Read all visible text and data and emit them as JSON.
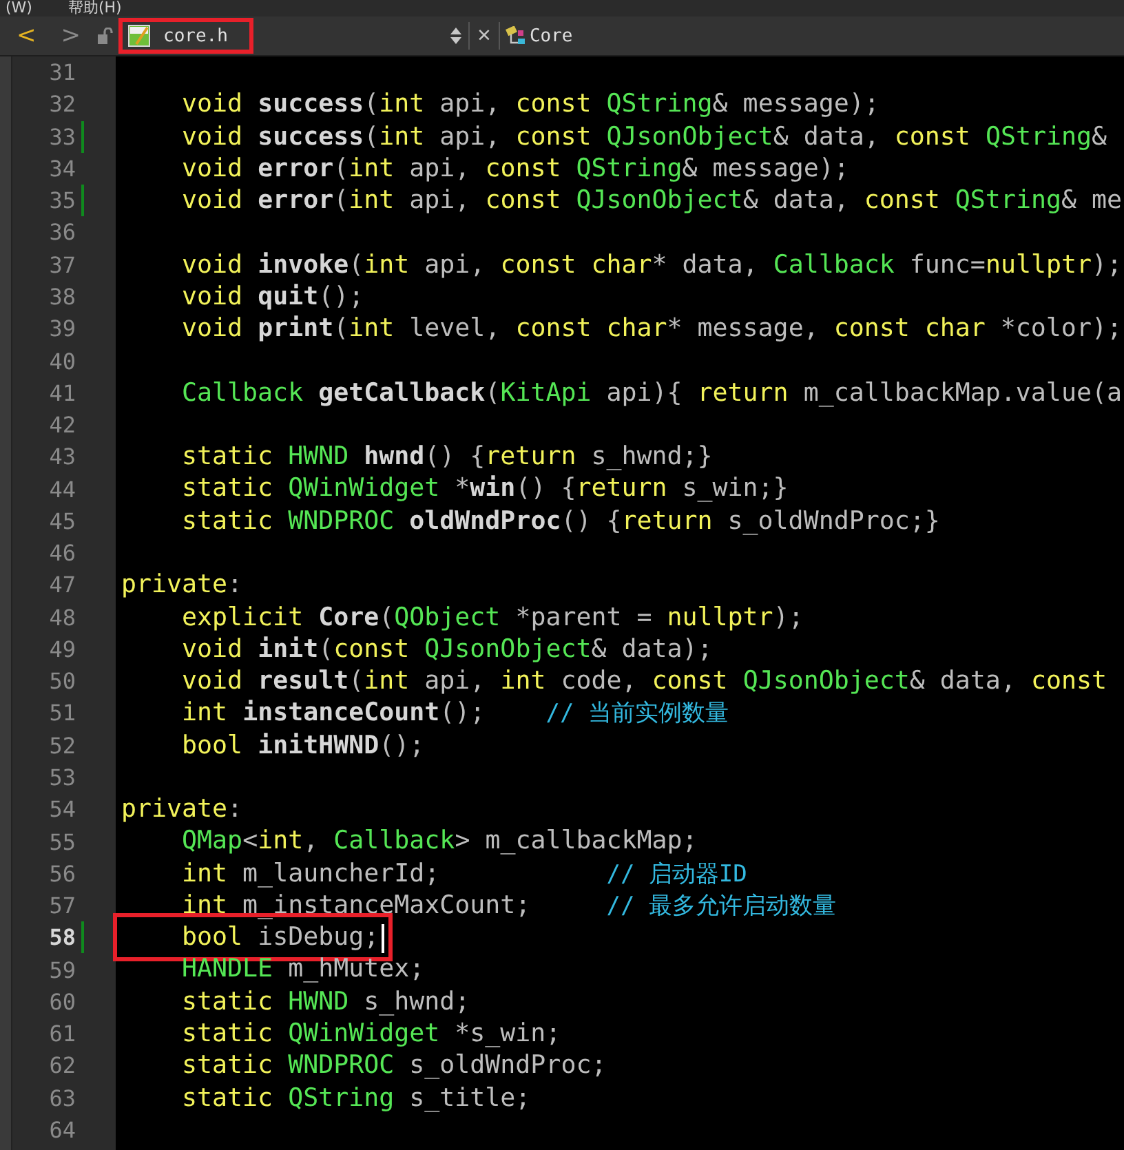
{
  "menu": [
    {
      "label": "(W)"
    },
    {
      "label": "帮助(H)"
    }
  ],
  "toolbar": {
    "back": {
      "label": "<",
      "disabled": false
    },
    "forward": {
      "label": ">",
      "disabled": true
    },
    "file": {
      "label": "core.h",
      "highlighted": true
    },
    "close": {
      "label": "×"
    },
    "symbol": {
      "label": "Core"
    }
  },
  "lines": [
    {
      "number": "31",
      "changed": false,
      "current": false
    },
    {
      "number": "32",
      "changed": false,
      "current": false,
      "tokens": [
        {
          "kind": "kw",
          "text": "    void "
        },
        {
          "kind": "fn",
          "text": "success"
        },
        {
          "kind": "pl",
          "text": "("
        },
        {
          "kind": "kw",
          "text": "int"
        },
        {
          "kind": "pl",
          "text": " api, "
        },
        {
          "kind": "kw",
          "text": "const "
        },
        {
          "kind": "ty",
          "text": "QString"
        },
        {
          "kind": "pl",
          "text": "& message);"
        }
      ]
    },
    {
      "number": "33",
      "changed": true,
      "current": false,
      "tokens": [
        {
          "kind": "kw",
          "text": "    void "
        },
        {
          "kind": "fn",
          "text": "success"
        },
        {
          "kind": "pl",
          "text": "("
        },
        {
          "kind": "kw",
          "text": "int"
        },
        {
          "kind": "pl",
          "text": " api, "
        },
        {
          "kind": "kw",
          "text": "const "
        },
        {
          "kind": "ty",
          "text": "QJsonObject"
        },
        {
          "kind": "pl",
          "text": "& data, "
        },
        {
          "kind": "kw",
          "text": "const "
        },
        {
          "kind": "ty",
          "text": "QString"
        },
        {
          "kind": "pl",
          "text": "&"
        }
      ]
    },
    {
      "number": "34",
      "changed": false,
      "current": false,
      "tokens": [
        {
          "kind": "kw",
          "text": "    void "
        },
        {
          "kind": "fn",
          "text": "error"
        },
        {
          "kind": "pl",
          "text": "("
        },
        {
          "kind": "kw",
          "text": "int"
        },
        {
          "kind": "pl",
          "text": " api, "
        },
        {
          "kind": "kw",
          "text": "const "
        },
        {
          "kind": "ty",
          "text": "QString"
        },
        {
          "kind": "pl",
          "text": "& message);"
        }
      ]
    },
    {
      "number": "35",
      "changed": true,
      "current": false,
      "tokens": [
        {
          "kind": "kw",
          "text": "    void "
        },
        {
          "kind": "fn",
          "text": "error"
        },
        {
          "kind": "pl",
          "text": "("
        },
        {
          "kind": "kw",
          "text": "int"
        },
        {
          "kind": "pl",
          "text": " api, "
        },
        {
          "kind": "kw",
          "text": "const "
        },
        {
          "kind": "ty",
          "text": "QJsonObject"
        },
        {
          "kind": "pl",
          "text": "& data, "
        },
        {
          "kind": "kw",
          "text": "const "
        },
        {
          "kind": "ty",
          "text": "QString"
        },
        {
          "kind": "pl",
          "text": "& me"
        }
      ]
    },
    {
      "number": "36",
      "changed": false,
      "current": false
    },
    {
      "number": "37",
      "changed": false,
      "current": false,
      "tokens": [
        {
          "kind": "kw",
          "text": "    void "
        },
        {
          "kind": "fn",
          "text": "invoke"
        },
        {
          "kind": "pl",
          "text": "("
        },
        {
          "kind": "kw",
          "text": "int"
        },
        {
          "kind": "pl",
          "text": " api, "
        },
        {
          "kind": "kw",
          "text": "const char"
        },
        {
          "kind": "pl",
          "text": "* data, "
        },
        {
          "kind": "ty",
          "text": "Callback"
        },
        {
          "kind": "pl",
          "text": " func="
        },
        {
          "kind": "kw",
          "text": "nullptr"
        },
        {
          "kind": "pl",
          "text": ");"
        }
      ]
    },
    {
      "number": "38",
      "changed": false,
      "current": false,
      "tokens": [
        {
          "kind": "kw",
          "text": "    void "
        },
        {
          "kind": "fn",
          "text": "quit"
        },
        {
          "kind": "pl",
          "text": "();"
        }
      ]
    },
    {
      "number": "39",
      "changed": false,
      "current": false,
      "tokens": [
        {
          "kind": "kw",
          "text": "    void "
        },
        {
          "kind": "fn",
          "text": "print"
        },
        {
          "kind": "pl",
          "text": "("
        },
        {
          "kind": "kw",
          "text": "int"
        },
        {
          "kind": "pl",
          "text": " level, "
        },
        {
          "kind": "kw",
          "text": "const char"
        },
        {
          "kind": "pl",
          "text": "* message, "
        },
        {
          "kind": "kw",
          "text": "const char"
        },
        {
          "kind": "pl",
          "text": " *color);"
        }
      ]
    },
    {
      "number": "40",
      "changed": false,
      "current": false
    },
    {
      "number": "41",
      "changed": false,
      "current": false,
      "tokens": [
        {
          "kind": "ty",
          "text": "    Callback "
        },
        {
          "kind": "fn",
          "text": "getCallback"
        },
        {
          "kind": "pl",
          "text": "("
        },
        {
          "kind": "ty",
          "text": "KitApi"
        },
        {
          "kind": "pl",
          "text": " api){ "
        },
        {
          "kind": "kw",
          "text": "return"
        },
        {
          "kind": "pl",
          "text": " m_callbackMap.value(a"
        }
      ]
    },
    {
      "number": "42",
      "changed": false,
      "current": false
    },
    {
      "number": "43",
      "changed": false,
      "current": false,
      "tokens": [
        {
          "kind": "kw",
          "text": "    static "
        },
        {
          "kind": "ty",
          "text": "HWND "
        },
        {
          "kind": "fn",
          "text": "hwnd"
        },
        {
          "kind": "pl",
          "text": "() {"
        },
        {
          "kind": "kw",
          "text": "return"
        },
        {
          "kind": "pl",
          "text": " s_hwnd;}"
        }
      ]
    },
    {
      "number": "44",
      "changed": false,
      "current": false,
      "tokens": [
        {
          "kind": "kw",
          "text": "    static "
        },
        {
          "kind": "ty",
          "text": "QWinWidget"
        },
        {
          "kind": "pl",
          "text": " *"
        },
        {
          "kind": "fn",
          "text": "win"
        },
        {
          "kind": "pl",
          "text": "() {"
        },
        {
          "kind": "kw",
          "text": "return"
        },
        {
          "kind": "pl",
          "text": " s_win;}"
        }
      ]
    },
    {
      "number": "45",
      "changed": false,
      "current": false,
      "tokens": [
        {
          "kind": "kw",
          "text": "    static "
        },
        {
          "kind": "ty",
          "text": "WNDPROC "
        },
        {
          "kind": "fn",
          "text": "oldWndProc"
        },
        {
          "kind": "pl",
          "text": "() {"
        },
        {
          "kind": "kw",
          "text": "return"
        },
        {
          "kind": "pl",
          "text": " s_oldWndProc;}"
        }
      ]
    },
    {
      "number": "46",
      "changed": false,
      "current": false
    },
    {
      "number": "47",
      "changed": false,
      "current": false,
      "tokens": [
        {
          "kind": "kw",
          "text": "private"
        },
        {
          "kind": "pl",
          "text": ":"
        }
      ]
    },
    {
      "number": "48",
      "changed": false,
      "current": false,
      "tokens": [
        {
          "kind": "kw",
          "text": "    explicit "
        },
        {
          "kind": "fn",
          "text": "Core"
        },
        {
          "kind": "pl",
          "text": "("
        },
        {
          "kind": "ty",
          "text": "QObject"
        },
        {
          "kind": "pl",
          "text": " *parent = "
        },
        {
          "kind": "kw",
          "text": "nullptr"
        },
        {
          "kind": "pl",
          "text": ");"
        }
      ]
    },
    {
      "number": "49",
      "changed": false,
      "current": false,
      "tokens": [
        {
          "kind": "kw",
          "text": "    void "
        },
        {
          "kind": "fn",
          "text": "init"
        },
        {
          "kind": "pl",
          "text": "("
        },
        {
          "kind": "kw",
          "text": "const "
        },
        {
          "kind": "ty",
          "text": "QJsonObject"
        },
        {
          "kind": "pl",
          "text": "& data);"
        }
      ]
    },
    {
      "number": "50",
      "changed": false,
      "current": false,
      "tokens": [
        {
          "kind": "kw",
          "text": "    void "
        },
        {
          "kind": "fn",
          "text": "result"
        },
        {
          "kind": "pl",
          "text": "("
        },
        {
          "kind": "kw",
          "text": "int"
        },
        {
          "kind": "pl",
          "text": " api, "
        },
        {
          "kind": "kw",
          "text": "int"
        },
        {
          "kind": "pl",
          "text": " code, "
        },
        {
          "kind": "kw",
          "text": "const "
        },
        {
          "kind": "ty",
          "text": "QJsonObject"
        },
        {
          "kind": "pl",
          "text": "& data, "
        },
        {
          "kind": "kw",
          "text": "const"
        }
      ]
    },
    {
      "number": "51",
      "changed": false,
      "current": false,
      "tokens": [
        {
          "kind": "kw",
          "text": "    int "
        },
        {
          "kind": "fn",
          "text": "instanceCount"
        },
        {
          "kind": "pl",
          "text": "();    "
        },
        {
          "kind": "cm",
          "text": "// 当前实例数量"
        }
      ]
    },
    {
      "number": "52",
      "changed": false,
      "current": false,
      "tokens": [
        {
          "kind": "kw",
          "text": "    bool "
        },
        {
          "kind": "fn",
          "text": "initHWND"
        },
        {
          "kind": "pl",
          "text": "();"
        }
      ]
    },
    {
      "number": "53",
      "changed": false,
      "current": false
    },
    {
      "number": "54",
      "changed": false,
      "current": false,
      "tokens": [
        {
          "kind": "kw",
          "text": "private"
        },
        {
          "kind": "pl",
          "text": ":"
        }
      ]
    },
    {
      "number": "55",
      "changed": false,
      "current": false,
      "tokens": [
        {
          "kind": "ty",
          "text": "    QMap"
        },
        {
          "kind": "pl",
          "text": "<"
        },
        {
          "kind": "kw",
          "text": "int"
        },
        {
          "kind": "pl",
          "text": ", "
        },
        {
          "kind": "ty",
          "text": "Callback"
        },
        {
          "kind": "pl",
          "text": "> m_callbackMap;"
        }
      ]
    },
    {
      "number": "56",
      "changed": false,
      "current": false,
      "tokens": [
        {
          "kind": "kw",
          "text": "    int"
        },
        {
          "kind": "pl",
          "text": " m_launcherId;           "
        },
        {
          "kind": "cm",
          "text": "// 启动器ID"
        }
      ]
    },
    {
      "number": "57",
      "changed": false,
      "current": false,
      "tokens": [
        {
          "kind": "kw",
          "text": "    int"
        },
        {
          "kind": "pl",
          "text": " m_instanceMaxCount;     "
        },
        {
          "kind": "cm",
          "text": "// 最多允许启动数量"
        }
      ]
    },
    {
      "number": "58",
      "changed": true,
      "current": true,
      "highlighted": true,
      "tokens": [
        {
          "kind": "kw",
          "text": "    bool"
        },
        {
          "kind": "pl",
          "text": " isDebug;"
        }
      ]
    },
    {
      "number": "59",
      "changed": false,
      "current": false,
      "tokens": [
        {
          "kind": "ty",
          "text": "    HANDLE"
        },
        {
          "kind": "pl",
          "text": " m_hMutex;"
        }
      ]
    },
    {
      "number": "60",
      "changed": false,
      "current": false,
      "tokens": [
        {
          "kind": "kw",
          "text": "    static "
        },
        {
          "kind": "ty",
          "text": "HWND"
        },
        {
          "kind": "pl",
          "text": " s_hwnd;"
        }
      ]
    },
    {
      "number": "61",
      "changed": false,
      "current": false,
      "tokens": [
        {
          "kind": "kw",
          "text": "    static "
        },
        {
          "kind": "ty",
          "text": "QWinWidget"
        },
        {
          "kind": "pl",
          "text": " *s_win;"
        }
      ]
    },
    {
      "number": "62",
      "changed": false,
      "current": false,
      "tokens": [
        {
          "kind": "kw",
          "text": "    static "
        },
        {
          "kind": "ty",
          "text": "WNDPROC"
        },
        {
          "kind": "pl",
          "text": " s_oldWndProc;"
        }
      ]
    },
    {
      "number": "63",
      "changed": false,
      "current": false,
      "tokens": [
        {
          "kind": "kw",
          "text": "    static "
        },
        {
          "kind": "ty",
          "text": "QString"
        },
        {
          "kind": "pl",
          "text": " s_title;"
        }
      ]
    },
    {
      "number": "64",
      "changed": false,
      "current": false
    }
  ]
}
